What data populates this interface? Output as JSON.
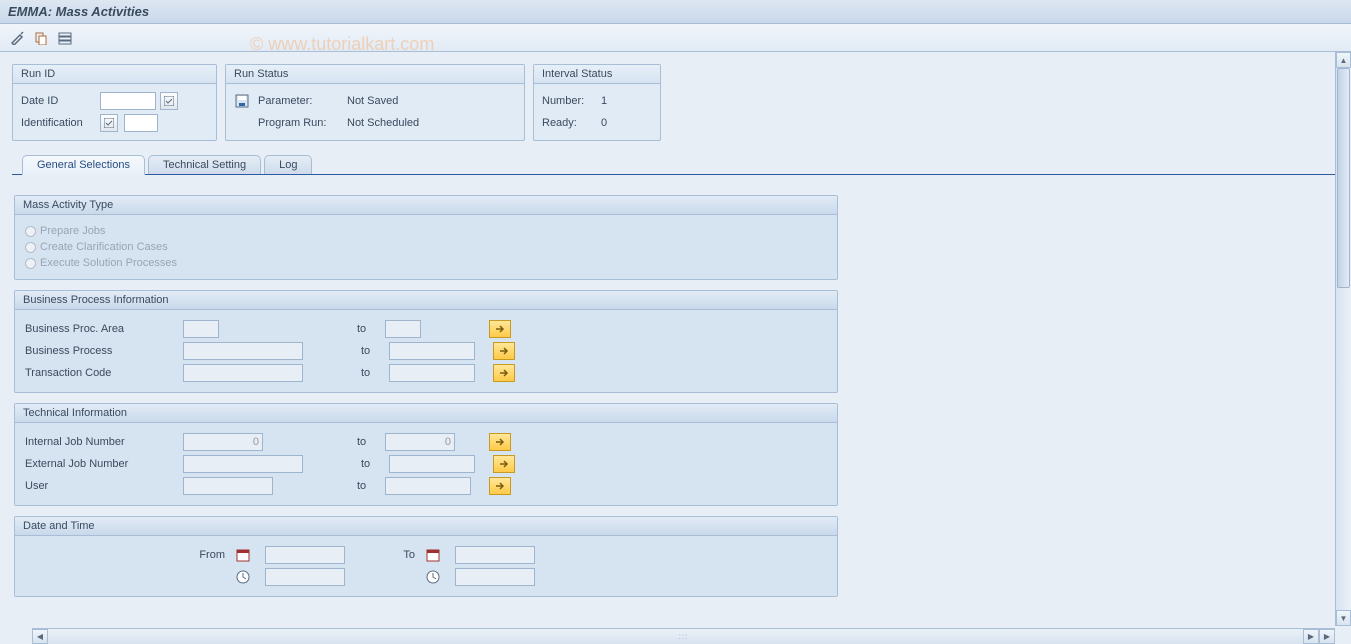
{
  "page": {
    "title": "EMMA: Mass Activities",
    "watermark": "© www.tutorialkart.com"
  },
  "runid": {
    "header": "Run ID",
    "date_label": "Date ID",
    "date_value": "",
    "ident_label": "Identification",
    "ident_value": ""
  },
  "runstatus": {
    "header": "Run Status",
    "param_label": "Parameter:",
    "param_value": "Not Saved",
    "prog_label": "Program Run:",
    "prog_value": "Not Scheduled"
  },
  "intstatus": {
    "header": "Interval Status",
    "num_label": "Number:",
    "num_value": "1",
    "ready_label": "Ready:",
    "ready_value": "0"
  },
  "tabs": {
    "general": "General Selections",
    "technical": "Technical Setting",
    "log": "Log"
  },
  "grp_type": {
    "header": "Mass Activity Type",
    "opt1": "Prepare Jobs",
    "opt2": "Create Clarification Cases",
    "opt3": "Execute Solution Processes"
  },
  "grp_bpi": {
    "header": "Business Process Information",
    "area_label": "Business Proc. Area",
    "proc_label": "Business Process",
    "tcode_label": "Transaction Code",
    "area_from": "",
    "area_to": "",
    "proc_from": "",
    "proc_to": "",
    "tcode_from": "",
    "tcode_to": "",
    "to_label": "to"
  },
  "grp_tech": {
    "header": "Technical Information",
    "ijob_label": "Internal Job Number",
    "ejob_label": "External Job Number",
    "user_label": "User",
    "ijob_from": "0",
    "ijob_to": "0",
    "ejob_from": "",
    "ejob_to": "",
    "user_from": "",
    "user_to": "",
    "to_label": "to"
  },
  "grp_dt": {
    "header": "Date and Time",
    "from_label": "From",
    "to_label": "To",
    "date_from": "",
    "date_to": "",
    "time_from": "",
    "time_to": ""
  }
}
